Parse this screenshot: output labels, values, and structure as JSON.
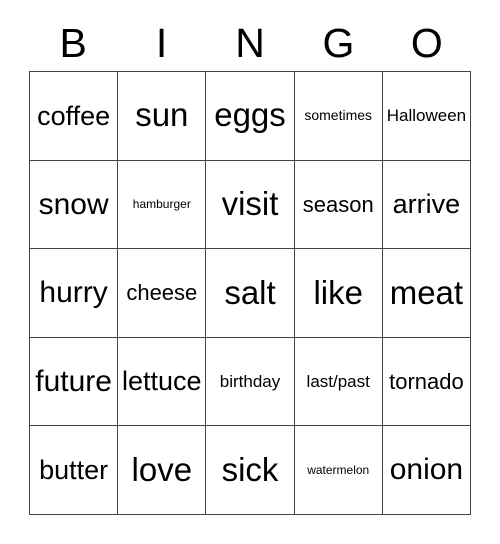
{
  "card": {
    "title": "BINGO",
    "headers": [
      "B",
      "I",
      "N",
      "G",
      "O"
    ],
    "grid_colors": {
      "border": "#444444",
      "background": "#ffffff",
      "text": "#000000"
    },
    "rows": [
      [
        {
          "label": "coffee",
          "size": "lg"
        },
        {
          "label": "sun",
          "size": "xxl"
        },
        {
          "label": "eggs",
          "size": "xxl"
        },
        {
          "label": "sometimes",
          "size": "xs"
        },
        {
          "label": "Halloween",
          "size": "sm"
        }
      ],
      [
        {
          "label": "snow",
          "size": "xl"
        },
        {
          "label": "hamburger",
          "size": "xxs"
        },
        {
          "label": "visit",
          "size": "xxl"
        },
        {
          "label": "season",
          "size": "md"
        },
        {
          "label": "arrive",
          "size": "lg"
        }
      ],
      [
        {
          "label": "hurry",
          "size": "xl"
        },
        {
          "label": "cheese",
          "size": "md"
        },
        {
          "label": "salt",
          "size": "xxl"
        },
        {
          "label": "like",
          "size": "xxl"
        },
        {
          "label": "meat",
          "size": "xxl"
        }
      ],
      [
        {
          "label": "future",
          "size": "xl"
        },
        {
          "label": "lettuce",
          "size": "lg"
        },
        {
          "label": "birthday",
          "size": "sm"
        },
        {
          "label": "last/past",
          "size": "sm"
        },
        {
          "label": "tornado",
          "size": "md"
        }
      ],
      [
        {
          "label": "butter",
          "size": "lg"
        },
        {
          "label": "love",
          "size": "xxl"
        },
        {
          "label": "sick",
          "size": "xxl"
        },
        {
          "label": "watermelon",
          "size": "xxs"
        },
        {
          "label": "onion",
          "size": "xl"
        }
      ]
    ]
  }
}
